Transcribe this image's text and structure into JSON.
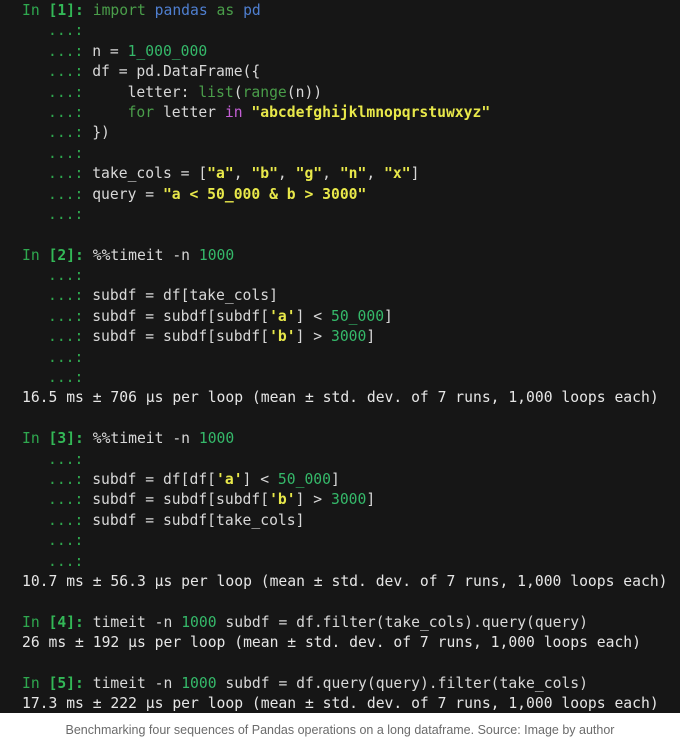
{
  "console": {
    "background_color": "#161616",
    "cells": [
      {
        "prompt": "In [1]:",
        "code_lines": [
          "import pandas as pd",
          "",
          "n = 1_000_000",
          "df = pd.DataFrame({",
          "    letter: list(range(n))",
          "    for letter in \"abcdefghijklmnopqrstuwxyz\"",
          "})",
          "",
          "take_cols = [\"a\", \"b\", \"g\", \"n\", \"x\"]",
          "query = \"a < 50_000 & b > 3000\"",
          ""
        ],
        "output": ""
      },
      {
        "prompt": "In [2]:",
        "code_lines": [
          "%%timeit -n 1000",
          "",
          "subdf = df[take_cols]",
          "subdf = subdf[subdf['a'] < 50_000]",
          "subdf = subdf[subdf['b'] > 3000]",
          "",
          ""
        ],
        "output": "16.5 ms ± 706 µs per loop (mean ± std. dev. of 7 runs, 1,000 loops each)"
      },
      {
        "prompt": "In [3]:",
        "code_lines": [
          "%%timeit -n 1000",
          "",
          "subdf = df[df['a'] < 50_000]",
          "subdf = subdf[subdf['b'] > 3000]",
          "subdf = subdf[take_cols]",
          "",
          ""
        ],
        "output": "10.7 ms ± 56.3 µs per loop (mean ± std. dev. of 7 runs, 1,000 loops each)"
      },
      {
        "prompt": "In [4]:",
        "code_lines": [
          "timeit -n 1000 subdf = df.filter(take_cols).query(query)"
        ],
        "output": "26 ms ± 192 µs per loop (mean ± std. dev. of 7 runs, 1,000 loops each)"
      },
      {
        "prompt": "In [5]:",
        "code_lines": [
          "timeit -n 1000 subdf = df.query(query).filter(take_cols)"
        ],
        "output": "17.3 ms ± 222 µs per loop (mean ± std. dev. of 7 runs, 1,000 loops each)"
      }
    ],
    "continuation_prompt": "...:",
    "tokens": {
      "c1_l1_in": "In",
      "c1_l1_num": " [1]:",
      "c1_l1_kw_import": " import",
      "c1_l1_mod_pandas": " pandas",
      "c1_l1_kw_as": " as",
      "c1_l1_mod_pd": " pd",
      "c1_l3_plain": " n = ",
      "c1_l3_num": "1_000_000",
      "c1_l4_plain": " df = pd.DataFrame({",
      "c1_l5_plain": "     letter: ",
      "c1_l5_fn_list": "list",
      "c1_l5_paren1": "(",
      "c1_l5_fn_range": "range",
      "c1_l5_rest": "(n))",
      "c1_l6_kw_for": "     for",
      "c1_l6_var": " letter ",
      "c1_l6_kw_in": "in",
      "c1_l6_str": " \"abcdefghijklmnopqrstuwxyz\"",
      "c1_l7_plain": " })",
      "c1_l9_plain": " take_cols = [",
      "c1_l9_s1": "\"a\"",
      "c1_l9_sep1": ", ",
      "c1_l9_s2": "\"b\"",
      "c1_l9_sep2": ", ",
      "c1_l9_s3": "\"g\"",
      "c1_l9_sep3": ", ",
      "c1_l9_s4": "\"n\"",
      "c1_l9_sep4": ", ",
      "c1_l9_s5": "\"x\"",
      "c1_l9_end": "]",
      "c1_l10_plain": " query = ",
      "c1_l10_str": "\"a < 50_000 & b > 3000\"",
      "c2_in": "In",
      "c2_num": " [2]:",
      "c2_magic": " %%timeit -n ",
      "c2_n": "1000",
      "c2_l3": " subdf = df[take_cols]",
      "c2_l4_a": " subdf = subdf[subdf[",
      "c2_l4_s": "'a'",
      "c2_l4_b": "] < ",
      "c2_l4_n": "50_000",
      "c2_l4_c": "]",
      "c2_l5_a": " subdf = subdf[subdf[",
      "c2_l5_s": "'b'",
      "c2_l5_b": "] > ",
      "c2_l5_n": "3000",
      "c2_l5_c": "]",
      "c3_in": "In",
      "c3_num": " [3]:",
      "c3_magic": " %%timeit -n ",
      "c3_n": "1000",
      "c3_l3_a": " subdf = df[df[",
      "c3_l3_s": "'a'",
      "c3_l3_b": "] < ",
      "c3_l3_n": "50_000",
      "c3_l3_c": "]",
      "c3_l4_a": " subdf = subdf[subdf[",
      "c3_l4_s": "'b'",
      "c3_l4_b": "] > ",
      "c3_l4_n": "3000",
      "c3_l4_c": "]",
      "c3_l5": " subdf = subdf[take_cols]",
      "c4_in": "In",
      "c4_num": " [4]:",
      "c4_a": " timeit -n ",
      "c4_n": "1000",
      "c4_b": " subdf = df.filter(take_cols).query(query)",
      "c5_in": "In",
      "c5_num": " [5]:",
      "c5_a": " timeit -n ",
      "c5_n": "1000",
      "c5_b": " subdf = df.query(query).filter(take_cols)"
    }
  },
  "caption": {
    "text": "Benchmarking four sequences of Pandas operations on a long dataframe. Source: Image by author"
  }
}
